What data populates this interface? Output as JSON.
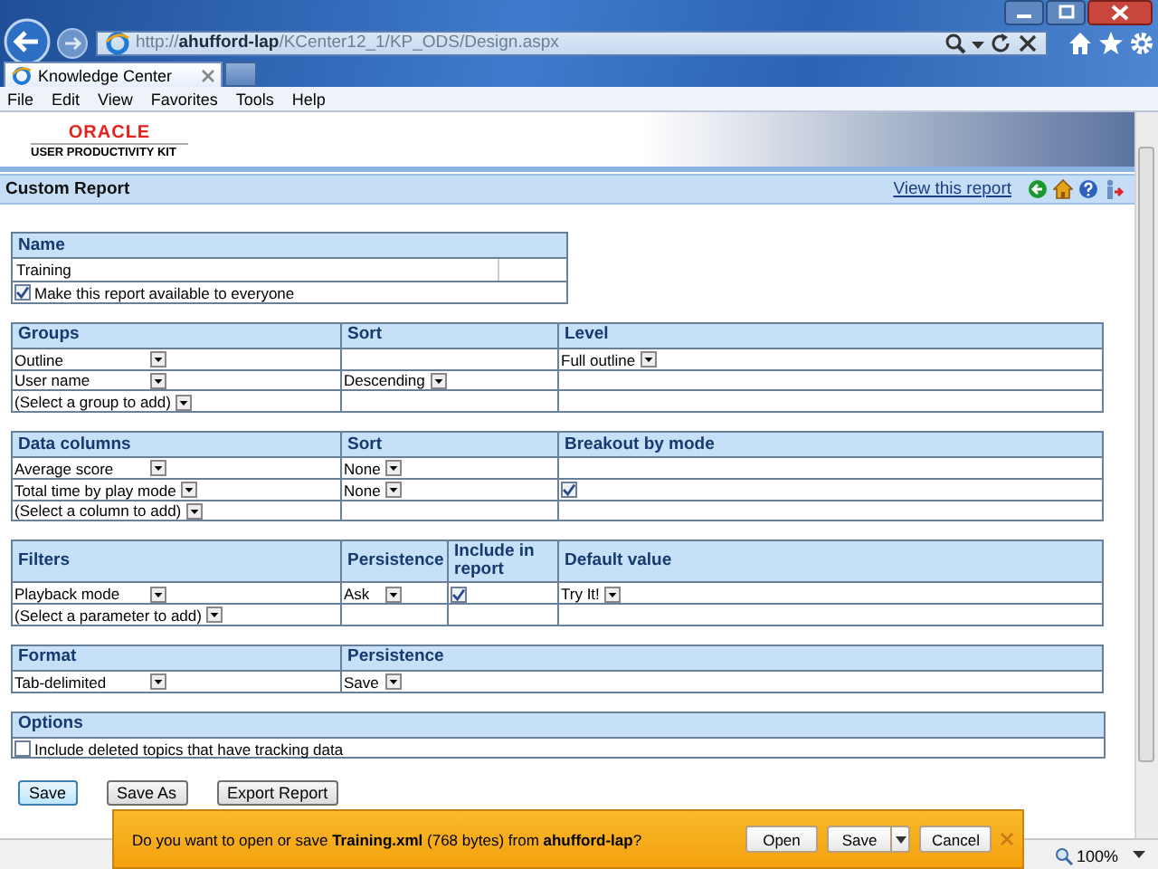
{
  "browser": {
    "address": "http://**ahufford-lap**/KCenter12_1/KP_ODS/Design.aspx",
    "tabs": [
      {
        "label": "Knowledge Center",
        "selected": true
      }
    ],
    "menu": [
      "File",
      "Edit",
      "View",
      "Favorites",
      "Tools",
      "Help"
    ]
  },
  "header": {
    "logo": "ORACLE",
    "subtitle": "USER PRODUCTIVITY KIT"
  },
  "page_title": "Custom Report",
  "view_link": "View this report",
  "sections": [
    {
      "kind": "name",
      "heading": "Name",
      "value": "Training",
      "checkbox": {
        "label": "Make this report available to everyone",
        "checked": true
      }
    },
    {
      "kind": "grid",
      "columns": [
        "Groups",
        "Sort",
        "Level"
      ],
      "rows": [
        [
          {
            "kind": "select",
            "value": "Outline"
          },
          null,
          {
            "kind": "select",
            "value": "Full outline"
          }
        ],
        [
          {
            "kind": "select",
            "value": "User name"
          },
          {
            "kind": "select",
            "value": "Descending"
          },
          null
        ],
        [
          {
            "kind": "select",
            "value": "(Select a group to add)"
          },
          null,
          null
        ]
      ]
    },
    {
      "kind": "grid",
      "columns": [
        "Data columns",
        "Sort",
        "Breakout by mode"
      ],
      "rows": [
        [
          {
            "kind": "select",
            "value": "Average score"
          },
          {
            "kind": "select",
            "value": "None"
          },
          null
        ],
        [
          {
            "kind": "select",
            "value": "Total time by play mode"
          },
          {
            "kind": "select",
            "value": "None"
          },
          {
            "kind": "check",
            "checked": true
          }
        ],
        [
          {
            "kind": "select",
            "value": "(Select a column to add)"
          },
          null,
          null
        ]
      ]
    },
    {
      "kind": "grid",
      "columns": [
        "Filters",
        "Persistence",
        "Include in report",
        "Default value"
      ],
      "rows": [
        [
          {
            "kind": "select",
            "value": "Playback mode"
          },
          {
            "kind": "select",
            "value": "Ask"
          },
          {
            "kind": "check",
            "checked": true
          },
          {
            "kind": "select",
            "value": "Try It!"
          }
        ],
        [
          {
            "kind": "select",
            "value": "(Select a parameter to add)"
          },
          null,
          null,
          null
        ]
      ]
    },
    {
      "kind": "grid",
      "columns": [
        "Format",
        "Persistence"
      ],
      "rows": [
        [
          {
            "kind": "select",
            "value": "Tab-delimited"
          },
          {
            "kind": "select",
            "value": "Save"
          }
        ]
      ]
    },
    {
      "kind": "grid",
      "columns": [
        "Options"
      ],
      "rows": [
        [
          {
            "kind": "check",
            "checked": false,
            "label": "Include deleted topics that have tracking data"
          }
        ]
      ]
    }
  ],
  "buttons": [
    "Save",
    "Save As",
    "Export Report"
  ],
  "notification": {
    "message": "Do you want to open or save **Training.xml** (768 bytes) from **ahufford-lap**?",
    "buttons": [
      {
        "label": "Open",
        "kind": "plain"
      },
      {
        "label": "Save",
        "kind": "split"
      },
      {
        "label": "Cancel",
        "kind": "plain"
      }
    ]
  },
  "status_bar": {
    "zoom": "100%"
  }
}
